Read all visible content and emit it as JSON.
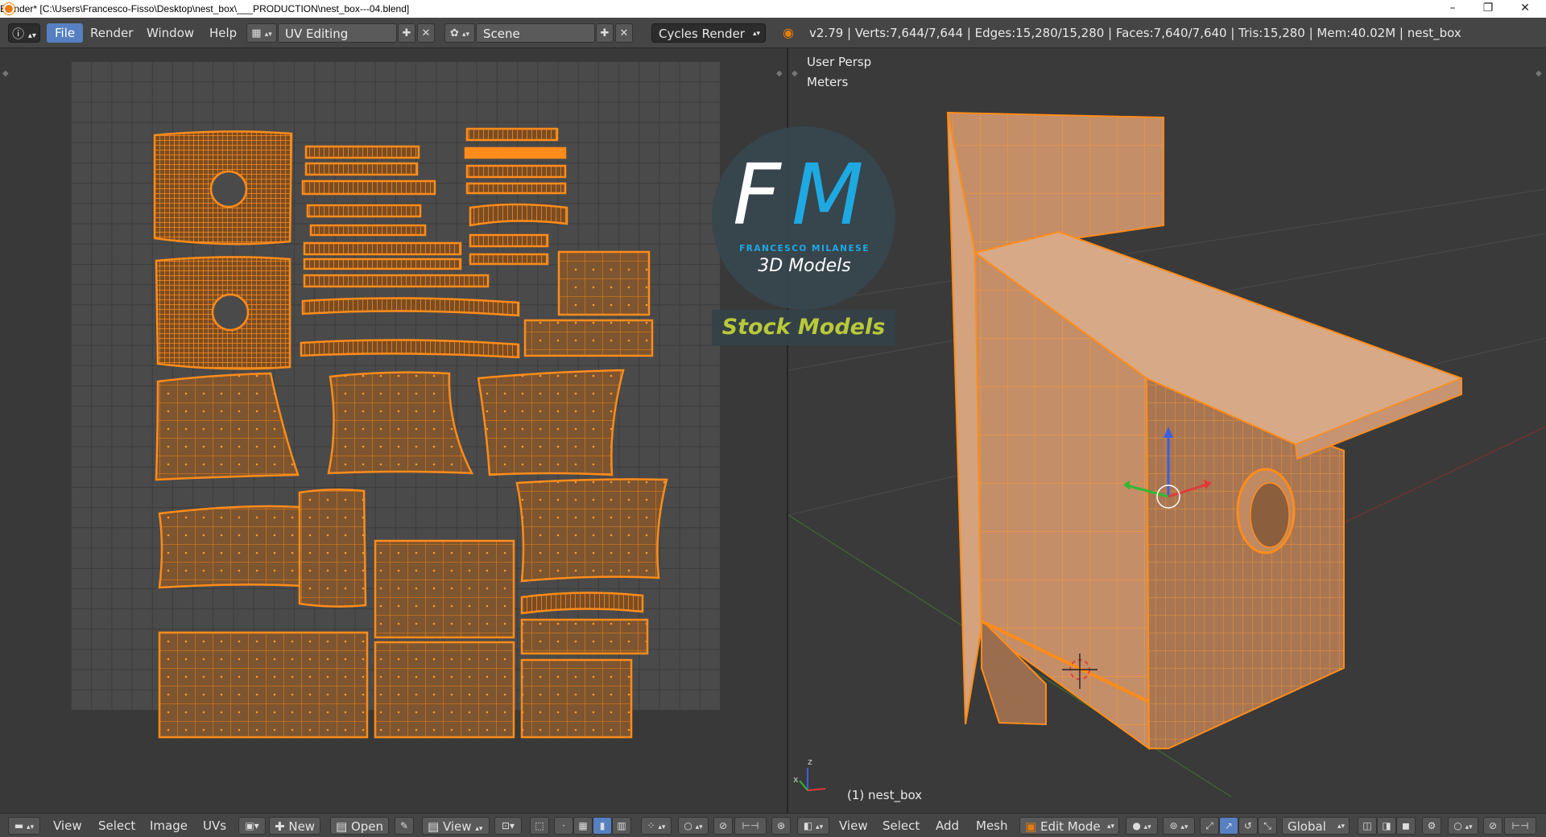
{
  "window": {
    "title": "Blender* [C:\\Users\\Francesco-Fisso\\Desktop\\nest_box\\___PRODUCTION\\nest_box---04.blend]",
    "minimize": "–",
    "restore": "❐",
    "close": "✕"
  },
  "info_header": {
    "info_icon": "ⓘ",
    "menus": [
      "File",
      "Render",
      "Window",
      "Help"
    ],
    "screen_layout": "UV Editing",
    "scene": "Scene",
    "render_engine": "Cycles Render",
    "stats": "v2.79 | Verts:7,644/7,644 | Edges:15,280/15,280 | Faces:7,640/7,640 | Tris:15,280 | Mem:40.02M | nest_box"
  },
  "viewport": {
    "view_name": "User Persp",
    "units": "Meters",
    "object_label": "(1) nest_box",
    "axis_x": "x",
    "axis_z": "z"
  },
  "watermark": {
    "letter_f": "F",
    "letter_m": "M",
    "author": "FRANCESCO MILANESE",
    "line1": "3D Models",
    "line2": "Stock Models",
    "color_blue": "#1ea9e2",
    "color_green": "#b8c93a"
  },
  "uv_footer": {
    "menus": [
      "View",
      "Select",
      "Image",
      "UVs"
    ],
    "new_label": "New",
    "open_label": "Open",
    "view_label": "View"
  },
  "view3d_footer": {
    "menus": [
      "View",
      "Select",
      "Add",
      "Mesh"
    ],
    "mode": "Edit Mode",
    "orientation": "Global"
  },
  "colors": {
    "uv_orange": "#ff8c1a",
    "header_bg": "#454545",
    "active_blue": "#5680c2",
    "mesh_face": "#d9a67a"
  },
  "icons": [
    "blender-icon",
    "info-icon",
    "screen-layout-icon",
    "scene-icon",
    "add-icon",
    "remove-icon",
    "render-engine-icon",
    "pin-icon",
    "image-icon",
    "editor-type-icon",
    "viewport-shading-icon",
    "pivot-icon",
    "manipulator-icon"
  ]
}
